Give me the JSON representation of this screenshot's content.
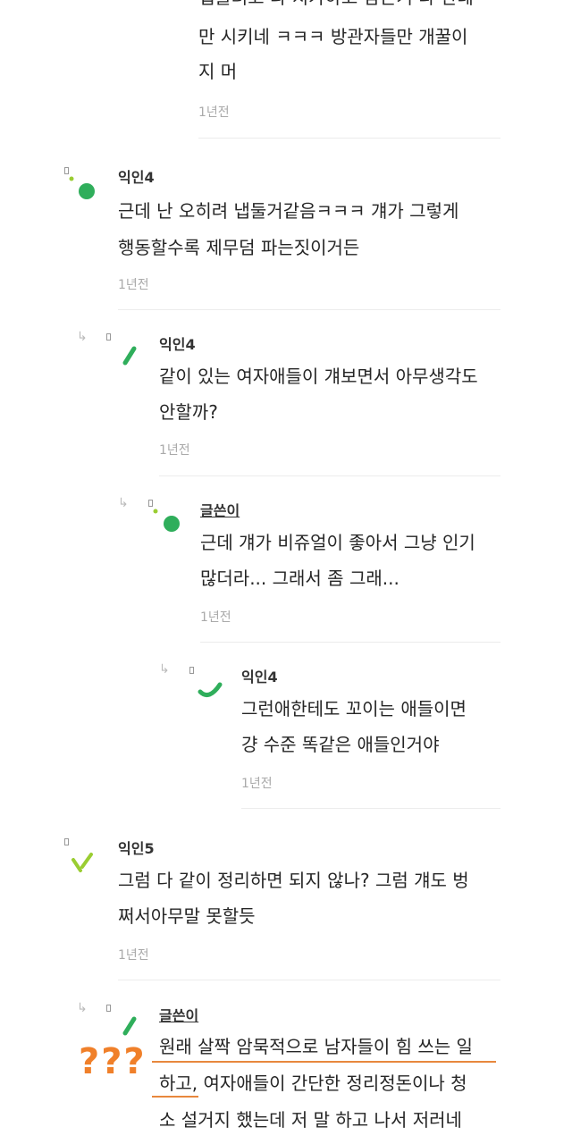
{
  "comments": [
    {
      "name": "",
      "lines": [
        "냅둘려고 다 치가하고 남는거 다 한테",
        "만 시키네 ㅋㅋㅋ 방관자들만 개꿀이",
        "지 머"
      ],
      "time": "1년전"
    },
    {
      "name": "익인4",
      "lines": [
        "근데 난 오히려 냅둘거같음ㅋㅋㅋ 걔가 그렇게",
        "행동할수록 제무덤 파는짓이거든"
      ],
      "time": "1년전"
    },
    {
      "name": "익인4",
      "lines": [
        "같이 있는 여자애들이 걔보면서 아무생각도",
        "안할까?"
      ],
      "time": "1년전"
    },
    {
      "name": "글쓴이",
      "lines": [
        "근데 걔가 비쥬얼이 좋아서 그냥 인기",
        "많더라... 그래서 좀 그래..."
      ],
      "time": "1년전"
    },
    {
      "name": "익인4",
      "lines": [
        "그런애한테도 꼬이는 애들이면",
        "걍 수준 똑같은 애들인거야"
      ],
      "time": "1년전"
    },
    {
      "name": "익인5",
      "lines": [
        "그럼 다 같이 정리하면 되지 않나? 그럼 걔도 벙",
        "쩌서아무말 못할듯"
      ],
      "time": "1년전"
    },
    {
      "name": "글쓴이",
      "lines": [
        "원래 살짝 암묵적으로 남자들이 힘 쓰는 일",
        "하고, 여자애들이 간단한 정리정돈이나 청",
        "소 설거지 했는데 저 말 하고 나서 저러네"
      ],
      "time": ""
    }
  ],
  "annotation": "???",
  "colors": {
    "avatar_green": "#2fae5b",
    "avatar_lime": "#9acd32",
    "annotation": "#f0802a"
  }
}
